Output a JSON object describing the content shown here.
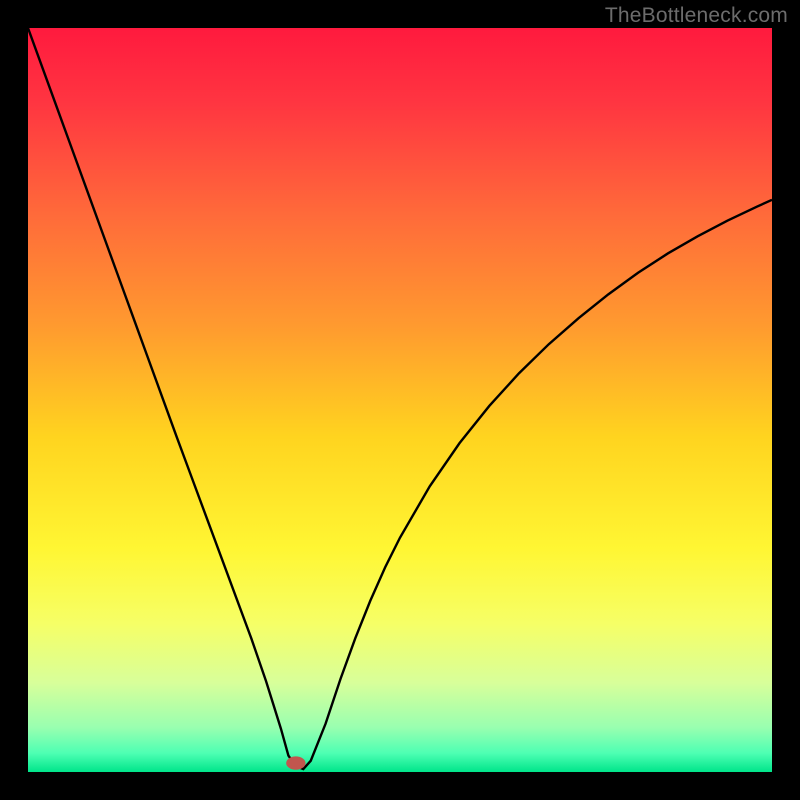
{
  "watermark": "TheBottleneck.com",
  "chart_data": {
    "type": "line",
    "title": "",
    "xlabel": "",
    "ylabel": "",
    "xlim": [
      0,
      100
    ],
    "ylim": [
      0,
      100
    ],
    "grid": false,
    "legend": false,
    "background": {
      "kind": "vertical-gradient",
      "stops": [
        {
          "pos": 0.0,
          "color": "#ff1a3e"
        },
        {
          "pos": 0.1,
          "color": "#ff3541"
        },
        {
          "pos": 0.25,
          "color": "#ff6a3a"
        },
        {
          "pos": 0.4,
          "color": "#ff9a2f"
        },
        {
          "pos": 0.55,
          "color": "#ffd41f"
        },
        {
          "pos": 0.7,
          "color": "#fff633"
        },
        {
          "pos": 0.8,
          "color": "#f6ff66"
        },
        {
          "pos": 0.88,
          "color": "#d8ff9a"
        },
        {
          "pos": 0.94,
          "color": "#99ffb0"
        },
        {
          "pos": 0.975,
          "color": "#4dffb3"
        },
        {
          "pos": 1.0,
          "color": "#00e58a"
        }
      ]
    },
    "series": [
      {
        "name": "bottleneck-curve",
        "color": "#000000",
        "width": 2.4,
        "x": [
          0,
          2,
          4,
          6,
          8,
          10,
          12,
          14,
          16,
          18,
          20,
          22,
          24,
          26,
          28,
          30,
          32,
          33,
          34,
          35,
          36,
          37,
          38,
          40,
          42,
          44,
          46,
          48,
          50,
          54,
          58,
          62,
          66,
          70,
          74,
          78,
          82,
          86,
          90,
          94,
          98,
          100
        ],
        "y": [
          100,
          94.5,
          89.0,
          83.5,
          78.0,
          72.5,
          67.0,
          61.5,
          56.0,
          50.5,
          45.0,
          39.6,
          34.2,
          28.8,
          23.4,
          18.0,
          12.2,
          9.0,
          5.8,
          2.2,
          0.8,
          0.4,
          1.5,
          6.5,
          12.5,
          18.0,
          23.0,
          27.5,
          31.5,
          38.4,
          44.2,
          49.2,
          53.6,
          57.5,
          61.0,
          64.2,
          67.1,
          69.7,
          72.0,
          74.1,
          76.0,
          76.9
        ]
      }
    ],
    "marker": {
      "name": "optimal-point",
      "x": 36.0,
      "y": 1.2,
      "color": "#c1564e",
      "rx": 1.3,
      "ry": 0.9
    }
  }
}
